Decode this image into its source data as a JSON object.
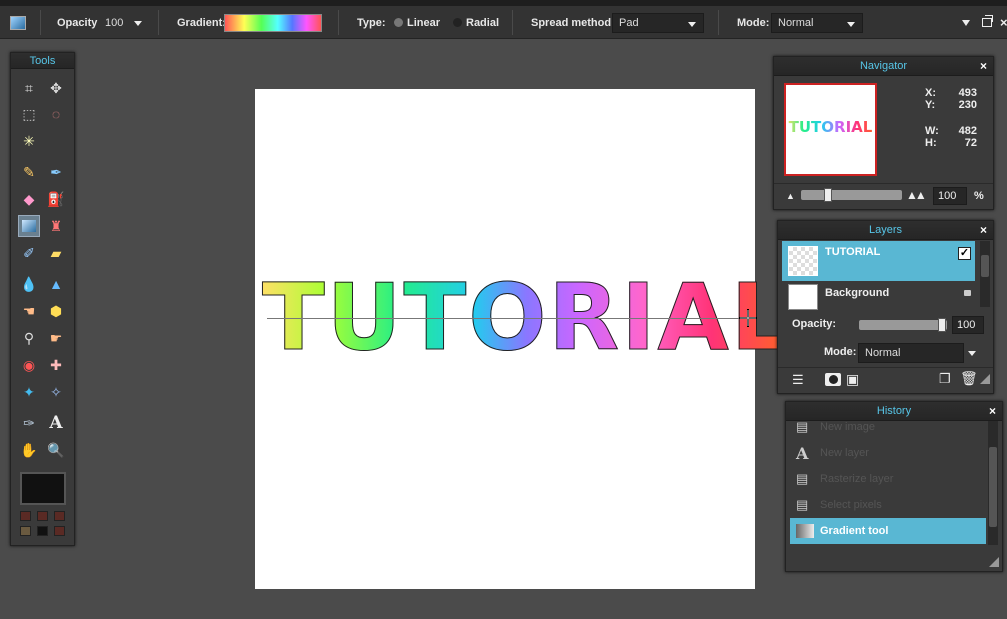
{
  "options": {
    "opacity_label": "Opacity:",
    "opacity_value": "100",
    "gradient_label": "Gradient:",
    "type_label": "Type:",
    "type_linear": "Linear",
    "type_radial": "Radial",
    "spread_label": "Spread method:",
    "spread_value": "Pad",
    "mode_label": "Mode:",
    "mode_value": "Normal"
  },
  "tools": {
    "title": "Tools",
    "foreground_color": "#111111",
    "swatches": [
      "#5a2a24",
      "#5a2a24",
      "#5a2a24",
      "#6a5a40",
      "#111111",
      "#5a2a24"
    ]
  },
  "canvas": {
    "text": "TUTORIAL"
  },
  "navigator": {
    "title": "Navigator",
    "thumb_text": "TUTORIAL",
    "x_label": "X:",
    "x_value": "493",
    "y_label": "Y:",
    "y_value": "230",
    "w_label": "W:",
    "w_value": "482",
    "h_label": "H:",
    "h_value": "72",
    "zoom_value": "100",
    "zoom_unit": "%"
  },
  "layers": {
    "title": "Layers",
    "items": [
      {
        "name": "TUTORIAL"
      },
      {
        "name": "Background"
      }
    ],
    "opacity_label": "Opacity:",
    "opacity_value": "100",
    "mode_label": "Mode:",
    "mode_value": "Normal"
  },
  "history": {
    "title": "History",
    "items": [
      {
        "label": "New image"
      },
      {
        "label": "New layer"
      },
      {
        "label": "Rasterize layer"
      },
      {
        "label": "Select pixels"
      },
      {
        "label": "Gradient tool"
      }
    ]
  }
}
